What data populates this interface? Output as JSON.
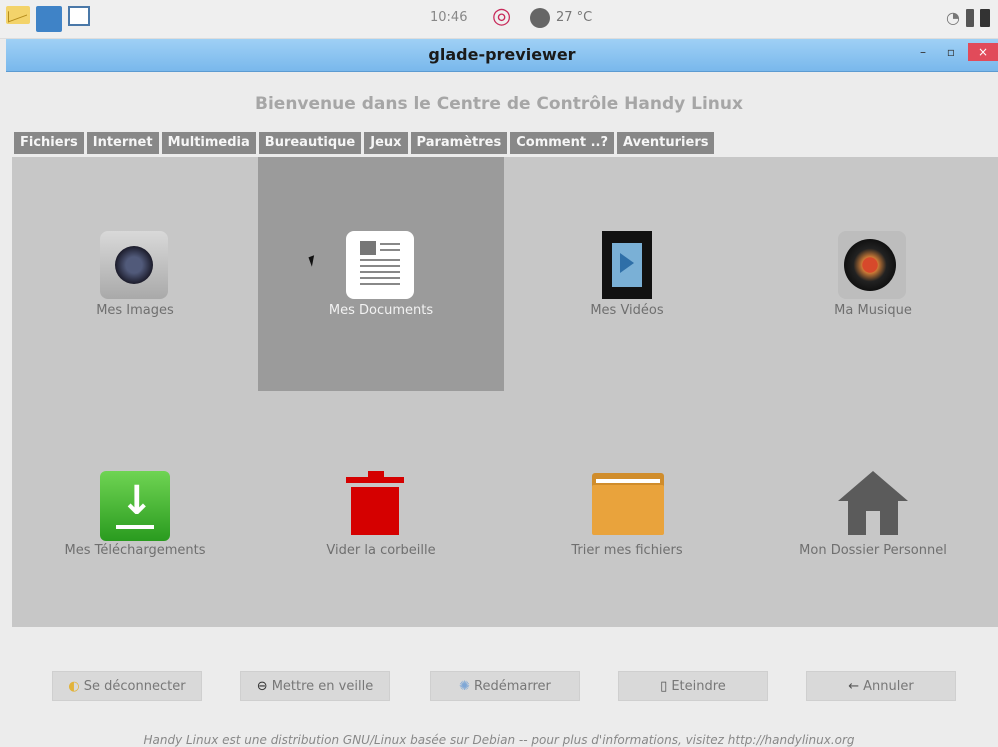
{
  "panel": {
    "clock": "10:46",
    "temperature": "27 °C",
    "icons": [
      "envelope-icon",
      "app-icon",
      "window-icon",
      "debian-icon",
      "weather-icon",
      "wifi-icon",
      "battery-icon"
    ]
  },
  "window": {
    "title": "glade-previewer",
    "buttons": {
      "minimize": "–",
      "maximize": "▫",
      "close": "×"
    }
  },
  "welcome": "Bienvenue dans le Centre de Contrôle Handy Linux",
  "tabs": [
    {
      "label": "Fichiers",
      "active": true
    },
    {
      "label": "Internet"
    },
    {
      "label": "Multimedia"
    },
    {
      "label": "Bureautique"
    },
    {
      "label": "Jeux"
    },
    {
      "label": "Paramètres"
    },
    {
      "label": "Comment ..?"
    },
    {
      "label": "Aventuriers"
    }
  ],
  "tiles": [
    {
      "label": "Mes Images",
      "icon": "camera-icon"
    },
    {
      "label": "Mes Documents",
      "icon": "document-icon",
      "selected": true
    },
    {
      "label": "Mes Vidéos",
      "icon": "film-icon"
    },
    {
      "label": "Ma Musique",
      "icon": "vinyl-icon"
    },
    {
      "label": "Mes Téléchargements",
      "icon": "download-icon"
    },
    {
      "label": "Vider la corbeille",
      "icon": "trash-icon"
    },
    {
      "label": "Trier mes fichiers",
      "icon": "folder-icon"
    },
    {
      "label": "Mon Dossier Personnel",
      "icon": "home-icon"
    }
  ],
  "actions": [
    {
      "label": "Se déconnecter",
      "icon": "logout-icon"
    },
    {
      "label": "Mettre en veille",
      "icon": "sleep-icon"
    },
    {
      "label": "Redémarrer",
      "icon": "restart-icon"
    },
    {
      "label": "Eteindre",
      "icon": "power-icon"
    },
    {
      "label": "Annuler",
      "icon": "back-arrow-icon"
    }
  ],
  "footer": "Handy Linux est une distribution GNU/Linux basée sur Debian -- pour plus d'informations, visitez http://handylinux.org",
  "colors": {
    "titlebar": "#79b8ec",
    "tab": "#888888",
    "selected_tile": "#9b9b9b",
    "trash": "#d50000",
    "download": "#2a9b1f",
    "folder": "#e9a33c"
  }
}
